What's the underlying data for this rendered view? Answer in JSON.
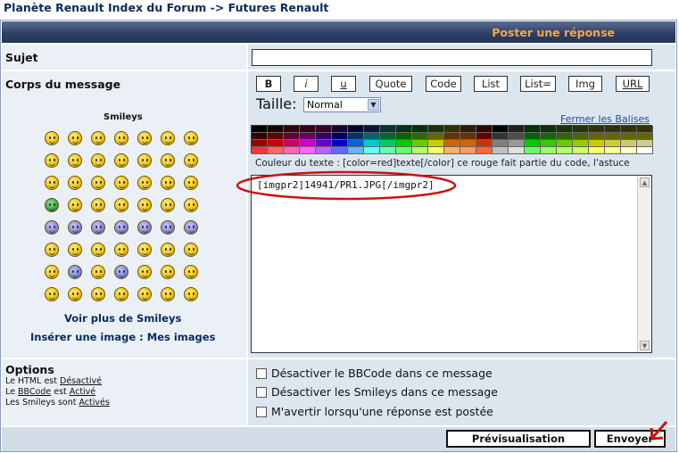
{
  "breadcrumb": "Planète Renault Index du Forum -> Futures Renault",
  "header_title": "Poster une réponse",
  "subject_label": "Sujet",
  "body_label": "Corps du message",
  "smileys_title": "Smileys",
  "more_smileys": "Voir plus de Smileys",
  "insert_image": "Insérer une image : Mes images",
  "bbcode_buttons": [
    "B",
    "i",
    "u",
    "Quote",
    "Code",
    "List",
    "List=",
    "Img",
    "URL"
  ],
  "size_label": "Taille:",
  "size_value": "Normal",
  "close_tags": "Fermer les Balises",
  "color_hint": "Couleur du texte : [color=red]texte[/color] ce rouge fait partie du code, l'astuce",
  "message_text": "[imgpr2]14941/PR1.JPG[/imgpr2]",
  "options_label": "Options",
  "html_status": {
    "prefix": "Le HTML est ",
    "value": "Désactivé"
  },
  "bbcode_status": {
    "prefix": "Le ",
    "link": "BBCode",
    "mid": " est ",
    "value": "Activé"
  },
  "smileys_status": {
    "prefix": "Les Smileys sont ",
    "value": "Activés"
  },
  "checkboxes": [
    "Désactiver le BBCode dans ce message",
    "Désactiver les Smileys dans ce message",
    "M'avertir lorsqu'une réponse est postée"
  ],
  "preview_button": "Prévisualisation",
  "submit_button": "Envoyer",
  "colors": {
    "header_text": "#f2a64a",
    "annotation_red": "#cc1111",
    "link": "#0b2a5c"
  }
}
